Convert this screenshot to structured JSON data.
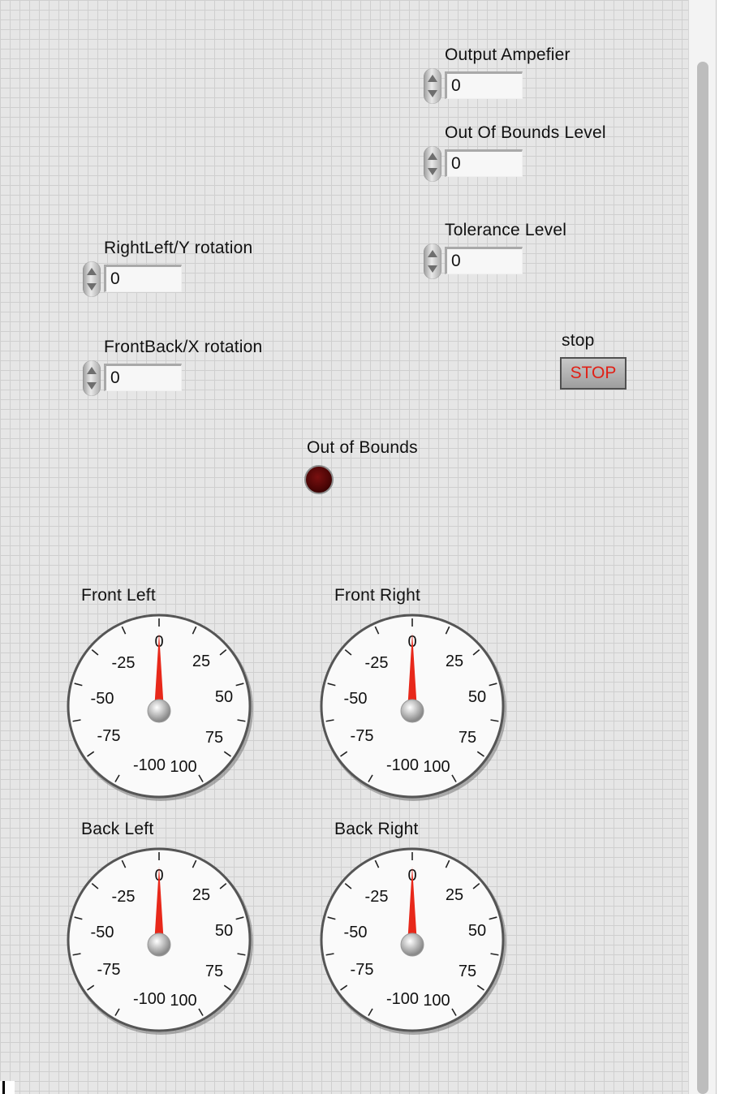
{
  "controls": {
    "output_ampefier": {
      "label": "Output Ampefier",
      "value": "0"
    },
    "out_of_bounds_level": {
      "label": "Out Of Bounds Level",
      "value": "0"
    },
    "tolerance_level": {
      "label": "Tolerance Level",
      "value": "0"
    },
    "rightleft_y_rotation": {
      "label": "RightLeft/Y rotation",
      "value": "0"
    },
    "frontback_x_rotation": {
      "label": "FrontBack/X rotation",
      "value": "0"
    }
  },
  "stop": {
    "label": "stop",
    "button_text": "STOP",
    "text_color": "#e02016"
  },
  "indicator": {
    "label": "Out of Bounds",
    "led_color": "#4a0505",
    "state": "off"
  },
  "gauges": [
    {
      "label": "Front Left",
      "value": 0
    },
    {
      "label": "Front Right",
      "value": 0
    },
    {
      "label": "Back Left",
      "value": 0
    },
    {
      "label": "Back Right",
      "value": 0
    }
  ],
  "gauge_scale": {
    "min": -100,
    "max": 100,
    "tick_labels": [
      "-100",
      "-75",
      "-50",
      "-25",
      "0",
      "25",
      "50",
      "75",
      "100"
    ],
    "needle_color": "#e8281a"
  }
}
